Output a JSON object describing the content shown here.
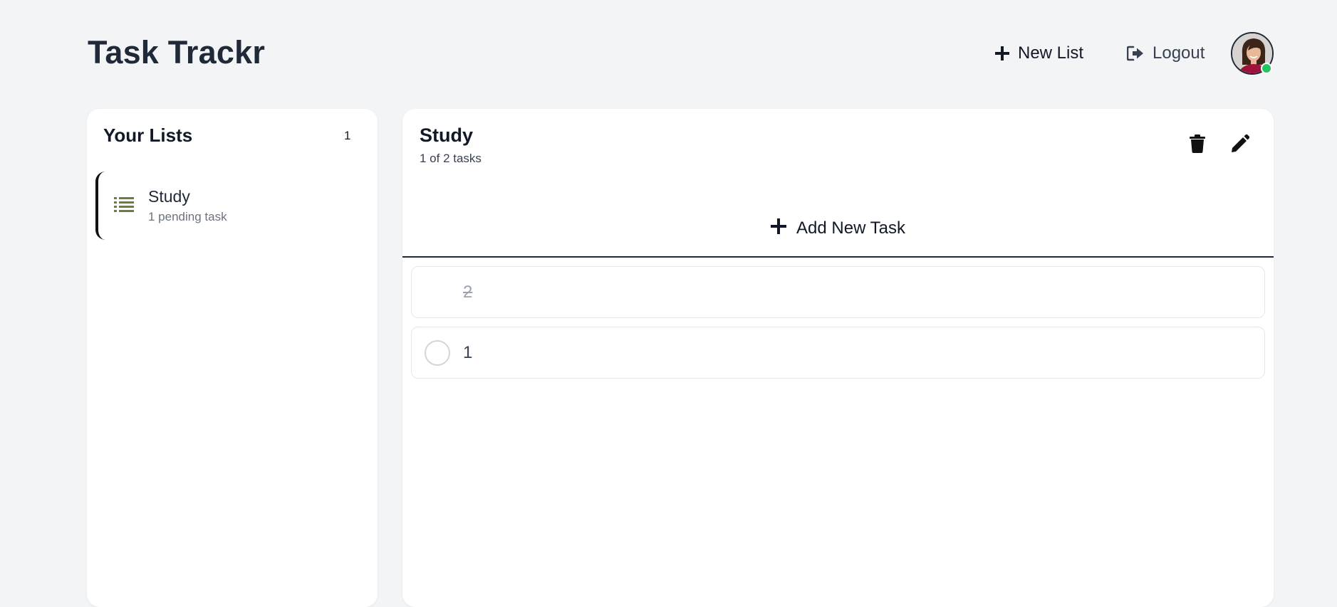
{
  "app": {
    "title": "Task Trackr"
  },
  "header": {
    "new_list_label": "New List",
    "logout_label": "Logout",
    "user_status": "online"
  },
  "sidebar": {
    "title": "Your Lists",
    "count": "1",
    "items": [
      {
        "name": "Study",
        "subtitle": "1 pending task",
        "icon": "list-icon",
        "active": true
      }
    ]
  },
  "main": {
    "list_title": "Study",
    "progress_text": "1 of 2 tasks",
    "add_task_label": "Add New Task",
    "tasks": [
      {
        "text": "2",
        "completed": true
      },
      {
        "text": "1",
        "completed": false
      }
    ]
  },
  "colors": {
    "background": "#f3f4f6",
    "panel": "#ffffff",
    "text_primary": "#1f2937",
    "list_icon": "#6b7f3a",
    "online_dot": "#22c55e",
    "completed_text": "#9ca3af"
  }
}
